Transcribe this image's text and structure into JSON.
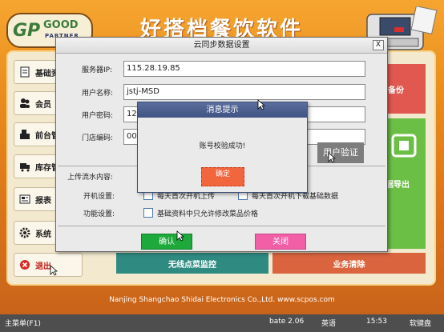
{
  "app": {
    "title": "好搭档餐饮软件",
    "logo": {
      "mark": "GP",
      "line1": "GOOD",
      "line2": "PARTNER"
    },
    "footer": "Nanjing Shangchao Shidai Electronics Co.,Ltd. www.scpos.com",
    "sidebar": [
      {
        "label": "基础资",
        "icon": "document-icon"
      },
      {
        "label": "会员",
        "icon": "users-icon"
      },
      {
        "label": "前台管",
        "icon": "cash-register-icon"
      },
      {
        "label": "库存管",
        "icon": "truck-icon"
      },
      {
        "label": "报表",
        "icon": "report-icon"
      },
      {
        "label": "系统",
        "icon": "gear-icon"
      },
      {
        "label": "退出",
        "icon": "exit-icon"
      }
    ],
    "tiles": {
      "backup": "备份",
      "export": "据导出",
      "wireless": "无线点菜监控",
      "clear": "业务清除"
    },
    "colors": {
      "tile_red": "#e0584f",
      "tile_green": "#6cbf45",
      "tile_teal": "#2f8a82",
      "tile_orange": "#d9643e"
    }
  },
  "dialog": {
    "title": "云同步数据设置",
    "close": "X",
    "fields": [
      {
        "label": "服务器IP:",
        "value": "115.28.19.85"
      },
      {
        "label": "用户名称:",
        "value": "jstj-MSD"
      },
      {
        "label": "用户密码:",
        "value": "123"
      },
      {
        "label": "门店编码:",
        "value": "000"
      }
    ],
    "verify_button": "用户验证",
    "upload_label": "上传流水内容:",
    "startup_label": "开机设置:",
    "function_label": "功能设置:",
    "checkboxes": {
      "upload_daily": "每天首次开机上传",
      "download_daily": "每天首次开机下载基础数据",
      "price_edit": "基础资料中只允许修改菜品价格"
    },
    "confirm_button": "确认",
    "close_button": "关闭"
  },
  "message": {
    "title": "消息提示",
    "text": "账号校验成功!",
    "ok": "确定"
  },
  "taskbar": {
    "menu": "主菜单(F1)",
    "version": "bate 2.06",
    "language": "英语",
    "time": "15:53",
    "keyboard": "软键盘"
  }
}
